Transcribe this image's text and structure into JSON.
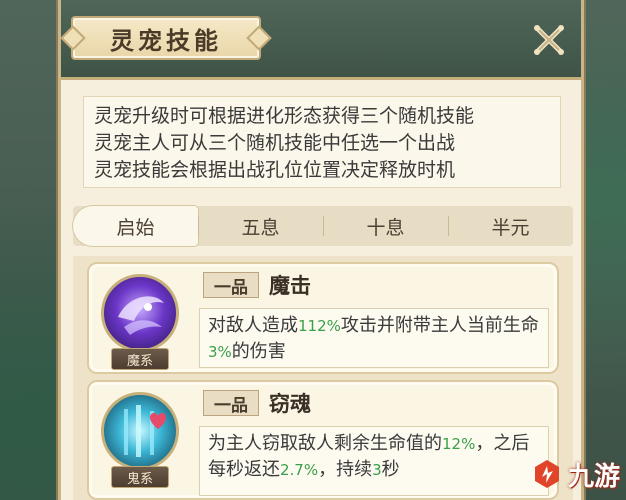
{
  "window": {
    "title": "灵宠技能",
    "close_icon": "close-x-icon"
  },
  "description": {
    "lines": [
      "灵宠升级时可根据进化形态获得三个随机技能",
      "灵宠主人可从三个随机技能中任选一个出战",
      "灵宠技能会根据出战孔位位置决定释放时机"
    ]
  },
  "tabs": [
    {
      "label": "启始",
      "active": true
    },
    {
      "label": "五息",
      "active": false
    },
    {
      "label": "十息",
      "active": false
    },
    {
      "label": "半元",
      "active": false
    }
  ],
  "skills": [
    {
      "grade": "一品",
      "name": "魔击",
      "element": "魔系",
      "icon": "demon-skill-icon",
      "desc": {
        "p1": "对敌人造成",
        "v1": "112%",
        "p2": "攻击并附带主人当前生命",
        "v2": "3%",
        "p3": "的伤害"
      }
    },
    {
      "grade": "一品",
      "name": "窃魂",
      "element": "鬼系",
      "icon": "ghost-skill-icon",
      "desc": {
        "p1": "为主人窃取敌人剩余生命值的",
        "v1": "12%",
        "p2": "，之后每秒返还",
        "v2": "2.7%",
        "p3": "，持续",
        "v3": "3",
        "p4": "秒"
      }
    }
  ],
  "watermark": {
    "text": "九游",
    "icon": "jiuyou-logo-icon"
  },
  "colors": {
    "highlight": "#3aa04a",
    "watermark_red": "#e0452a"
  }
}
